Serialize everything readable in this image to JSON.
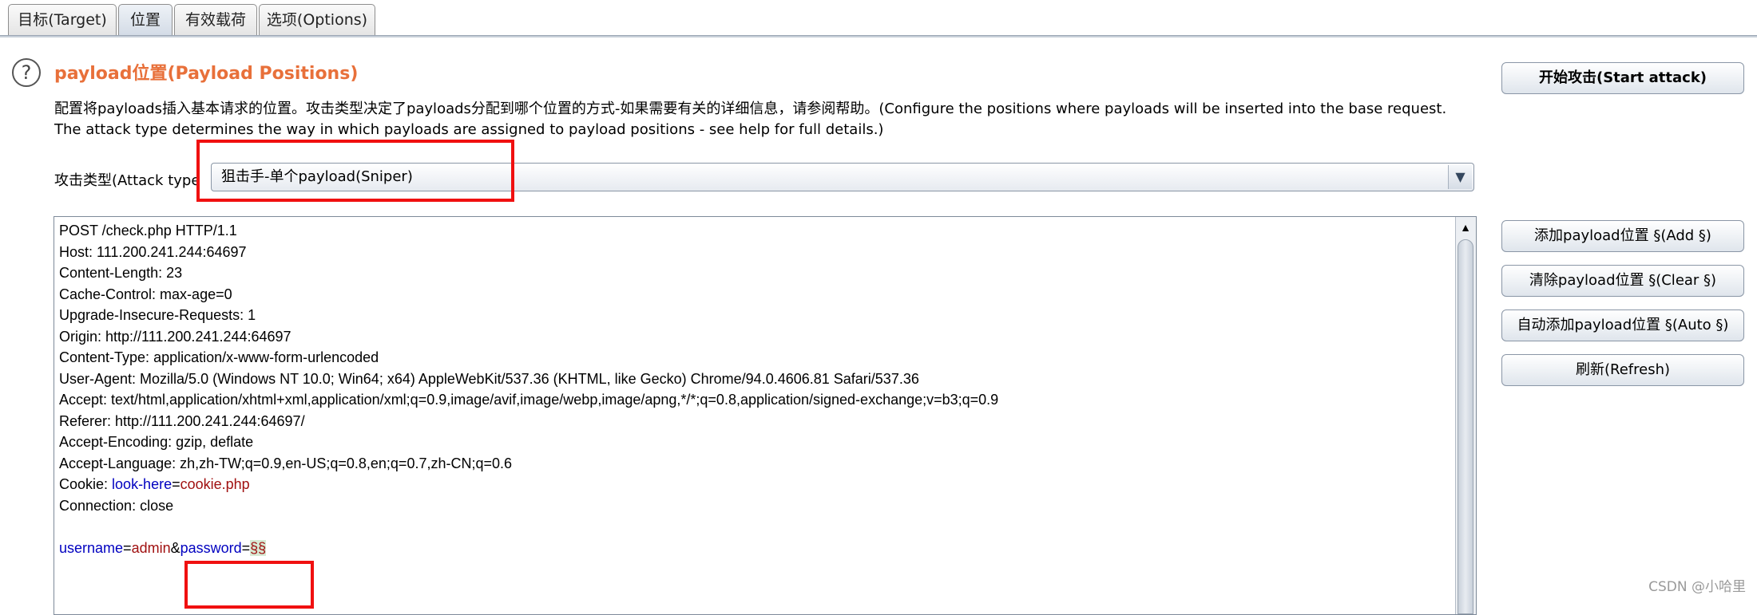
{
  "tabs": [
    {
      "label": "目标(Target)",
      "active": false
    },
    {
      "label": "位置",
      "active": true
    },
    {
      "label": "有效载荷",
      "active": false
    },
    {
      "label": "选项(Options)",
      "active": false
    }
  ],
  "section": {
    "help_icon_glyph": "?",
    "title": "payload位置(Payload Positions)",
    "description": "配置将payloads插入基本请求的位置。攻击类型决定了payloads分配到哪个位置的方式-如果需要有关的详细信息，请参阅帮助。(Configure the positions where payloads will be inserted into the base request. The attack type determines the way in which payloads are assigned to payload positions - see help for full details.)"
  },
  "attack_type": {
    "label": "攻击类型(Attack type",
    "selected": "狙击手-单个payload(Sniper)",
    "arrow_icon": "▼"
  },
  "request": {
    "lines": [
      "POST /check.php HTTP/1.1",
      "Host: 111.200.241.244:64697",
      "Content-Length: 23",
      "Cache-Control: max-age=0",
      "Upgrade-Insecure-Requests: 1",
      "Origin: http://111.200.241.244:64697",
      "Content-Type: application/x-www-form-urlencoded",
      "User-Agent: Mozilla/5.0 (Windows NT 10.0; Win64; x64) AppleWebKit/537.36 (KHTML, like Gecko) Chrome/94.0.4606.81 Safari/537.36",
      "Accept: text/html,application/xhtml+xml,application/xml;q=0.9,image/avif,image/webp,image/apng,*/*;q=0.8,application/signed-exchange;v=b3;q=0.9",
      "Referer: http://111.200.241.244:64697/",
      "Accept-Encoding: gzip, deflate",
      "Accept-Language: zh,zh-TW;q=0.9,en-US;q=0.8,en;q=0.7,zh-CN;q=0.6"
    ],
    "cookie": {
      "prefix": "Cookie: ",
      "key": "look-here",
      "eq": "=",
      "value": "cookie.php"
    },
    "connection": "Connection: close",
    "body": {
      "k1": "username",
      "eq1": "=",
      "v1": "admin",
      "amp": "&",
      "k2": "password",
      "eq2": "=",
      "marker": "§§"
    }
  },
  "buttons": {
    "start_attack": "开始攻击(Start attack)",
    "add": "添加payload位置 §(Add §)",
    "clear": "清除payload位置 §(Clear §)",
    "auto": "自动添加payload位置 §(Auto §)",
    "refresh": "刷新(Refresh)"
  },
  "scrollbar": {
    "up_icon": "▲"
  },
  "watermark": "CSDN @小哈里",
  "colors": {
    "title": "#e8703a",
    "highlight_box": "#f01010",
    "param_key": "#0000c0",
    "param_value": "#a01010"
  }
}
